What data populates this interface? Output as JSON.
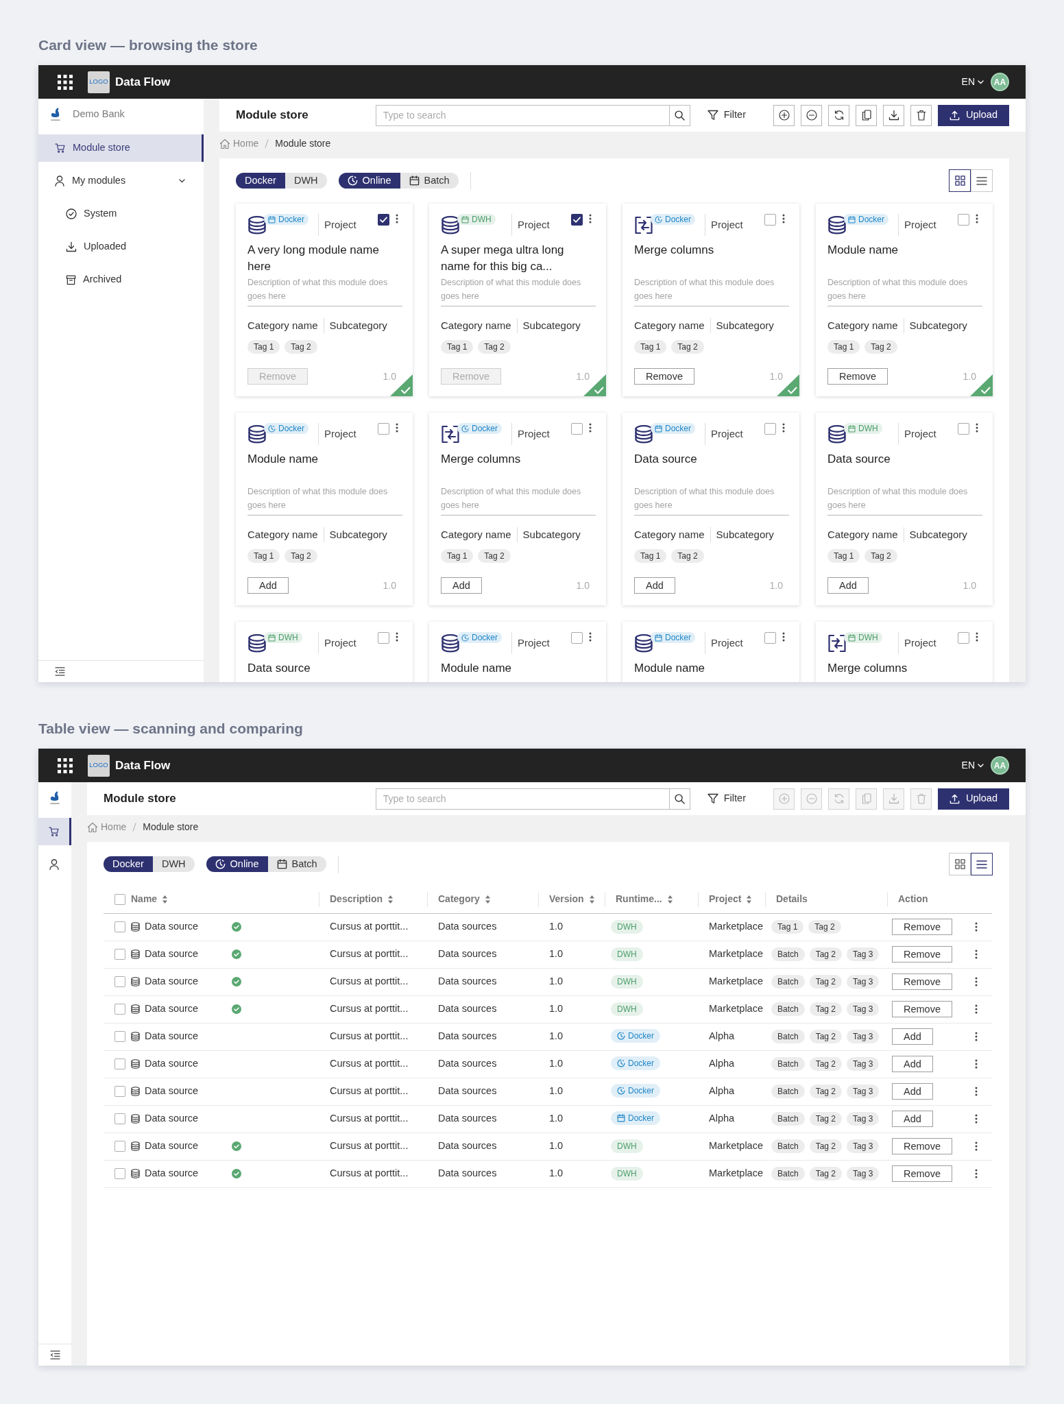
{
  "views": [
    {
      "kind": "cards",
      "caption": "Card view — browsing the store",
      "header": {
        "logo": "LOGO",
        "app_name": "Data Flow",
        "language": "EN",
        "avatar": "AA"
      },
      "sidebar": {
        "collapsed": false,
        "org": "Demo Bank",
        "items": [
          {
            "label": "Module store",
            "selected": true
          },
          {
            "label": "My modules",
            "selected": false,
            "expanded": true,
            "children": [
              {
                "label": "System",
                "selected": false
              },
              {
                "label": "Uploaded",
                "selected": false
              },
              {
                "label": "Archived",
                "selected": false
              }
            ]
          }
        ]
      },
      "toolbar": {
        "title": "Module store",
        "search": {
          "placeholder": "Type to search"
        },
        "filter": "Filter",
        "actions": [
          {
            "disabled": false
          },
          {
            "disabled": false
          },
          {
            "disabled": false
          },
          {
            "disabled": false
          },
          {
            "disabled": false
          },
          {
            "disabled": false
          }
        ],
        "upload": "Upload"
      },
      "breadcrumb": [
        "Home",
        "Module store"
      ],
      "filters": [
        [
          {
            "label": "Docker",
            "selected": true
          },
          {
            "label": "DWH",
            "selected": false
          }
        ],
        [
          {
            "label": "Online",
            "kind": "online",
            "selected": true
          },
          {
            "label": "Batch",
            "kind": "batch",
            "selected": false
          }
        ]
      ],
      "view_toggle": [
        {
          "selected": true
        },
        {
          "selected": false
        }
      ],
      "cards": [
        {
          "kind": "database",
          "runtime": {
            "label": "Docker",
            "kind": "batch",
            "color": "#1f86c8"
          },
          "project": "Project",
          "checked": true,
          "title": "A very long module name here",
          "description": "Description of what this module does goes here",
          "category": "Category name",
          "subcategory": "Subcategory",
          "tags": [
            "Tag 1",
            "Tag 2"
          ],
          "action": {
            "label": "Remove",
            "disabled": true
          },
          "version": "1.0",
          "installed": true
        },
        {
          "kind": "database",
          "runtime": {
            "label": "DWH",
            "kind": "batch",
            "color": "#4c9e6a"
          },
          "project": "Project",
          "checked": true,
          "title": "A super mega ultra long name for this big ca...",
          "description": "Description of what this module does goes here",
          "category": "Category name",
          "subcategory": "Subcategory",
          "tags": [
            "Tag 1",
            "Tag 2"
          ],
          "action": {
            "label": "Remove",
            "disabled": true
          },
          "version": "1.0",
          "installed": true
        },
        {
          "kind": "merge",
          "runtime": {
            "label": "Docker",
            "kind": "online",
            "color": "#1f86c8"
          },
          "project": "Project",
          "checked": false,
          "title": "Merge columns",
          "description": "Description of what this module does goes here",
          "category": "Category name",
          "subcategory": "Subcategory",
          "tags": [
            "Tag 1",
            "Tag 2"
          ],
          "action": {
            "label": "Remove",
            "disabled": false
          },
          "version": "1.0",
          "installed": true
        },
        {
          "kind": "database",
          "runtime": {
            "label": "Docker",
            "kind": "batch",
            "color": "#1f86c8"
          },
          "project": "Project",
          "checked": false,
          "title": "Module name",
          "description": "Description of what this module does goes here",
          "category": "Category name",
          "subcategory": "Subcategory",
          "tags": [
            "Tag 1",
            "Tag 2"
          ],
          "action": {
            "label": "Remove",
            "disabled": false
          },
          "version": "1.0",
          "installed": true
        },
        {
          "kind": "database",
          "runtime": {
            "label": "Docker",
            "kind": "online",
            "color": "#1f86c8"
          },
          "project": "Project",
          "checked": false,
          "title": "Module name",
          "description": "Description of what this module does goes here",
          "category": "Category name",
          "subcategory": "Subcategory",
          "tags": [
            "Tag 1",
            "Tag 2"
          ],
          "action": {
            "label": "Add",
            "disabled": false
          },
          "version": "1.0",
          "installed": false
        },
        {
          "kind": "merge",
          "runtime": {
            "label": "Docker",
            "kind": "online",
            "color": "#1f86c8"
          },
          "project": "Project",
          "checked": false,
          "title": "Merge columns",
          "description": "Description of what this module does goes here",
          "category": "Category name",
          "subcategory": "Subcategory",
          "tags": [
            "Tag 1",
            "Tag 2"
          ],
          "action": {
            "label": "Add",
            "disabled": false
          },
          "version": "1.0",
          "installed": false
        },
        {
          "kind": "database",
          "runtime": {
            "label": "Docker",
            "kind": "batch",
            "color": "#1f86c8"
          },
          "project": "Project",
          "checked": false,
          "title": "Data source",
          "description": "Description of what this module does goes here",
          "category": "Category name",
          "subcategory": "Subcategory",
          "tags": [
            "Tag 1",
            "Tag 2"
          ],
          "action": {
            "label": "Add",
            "disabled": false
          },
          "version": "1.0",
          "installed": false
        },
        {
          "kind": "database",
          "runtime": {
            "label": "DWH",
            "kind": "batch",
            "color": "#4c9e6a"
          },
          "project": "Project",
          "checked": false,
          "title": "Data source",
          "description": "Description of what this module does goes here",
          "category": "Category name",
          "subcategory": "Subcategory",
          "tags": [
            "Tag 1",
            "Tag 2"
          ],
          "action": {
            "label": "Add",
            "disabled": false
          },
          "version": "1.0",
          "installed": false
        },
        {
          "kind": "database",
          "runtime": {
            "label": "DWH",
            "kind": "batch",
            "color": "#4c9e6a"
          },
          "project": "Project",
          "checked": false,
          "title": "Data source"
        },
        {
          "kind": "database",
          "runtime": {
            "label": "Docker",
            "kind": "online",
            "color": "#1f86c8"
          },
          "project": "Project",
          "checked": false,
          "title": "Module name"
        },
        {
          "kind": "database",
          "runtime": {
            "label": "Docker",
            "kind": "batch",
            "color": "#1f86c8"
          },
          "project": "Project",
          "checked": false,
          "title": "Module name"
        },
        {
          "kind": "merge",
          "runtime": {
            "label": "DWH",
            "kind": "batch",
            "color": "#4c9e6a"
          },
          "project": "Project",
          "checked": false,
          "title": "Merge columns"
        }
      ]
    },
    {
      "kind": "table",
      "caption": "Table view — scanning and comparing",
      "header": {
        "logo": "LOGO",
        "app_name": "Data Flow",
        "language": "EN",
        "avatar": "AA"
      },
      "sidebar": {
        "collapsed": true,
        "items": [
          {
            "selected": true
          },
          {
            "selected": false
          }
        ]
      },
      "toolbar": {
        "title": "Module store",
        "search": {
          "placeholder": "Type to search"
        },
        "filter": "Filter",
        "actions": [
          {
            "disabled": true
          },
          {
            "disabled": true
          },
          {
            "disabled": true
          },
          {
            "disabled": true
          },
          {
            "disabled": true
          },
          {
            "disabled": true
          }
        ],
        "upload": "Upload"
      },
      "breadcrumb": [
        "Home",
        "Module store"
      ],
      "filters": [
        [
          {
            "label": "Docker",
            "selected": true
          },
          {
            "label": "DWH",
            "selected": false
          }
        ],
        [
          {
            "label": "Online",
            "kind": "online",
            "selected": true
          },
          {
            "label": "Batch",
            "kind": "batch",
            "selected": false
          }
        ]
      ],
      "view_toggle": [
        {
          "selected": false
        },
        {
          "selected": true
        }
      ],
      "table": {
        "all_checked": false,
        "columns": [
          {
            "label": "Name",
            "sortable": true
          },
          {
            "label": "Description",
            "sortable": true
          },
          {
            "label": "Category",
            "sortable": true
          },
          {
            "label": "Version",
            "sortable": true
          },
          {
            "label": "Runtime...",
            "sortable": true
          },
          {
            "label": "Project",
            "sortable": true
          },
          {
            "label": "Details",
            "sortable": false
          },
          {
            "label": "Action",
            "sortable": false
          }
        ],
        "rows": [
          {
            "checked": false,
            "name": "Data source",
            "installed": true,
            "description": "Cursus at porttit...",
            "category": "Data sources",
            "version": "1.0",
            "runtime": {
              "label": "DWH",
              "color": "#4c9e6a"
            },
            "project": "Marketplace",
            "tags": [
              "Tag 1",
              "Tag 2"
            ],
            "action": {
              "label": "Remove",
              "disabled": false
            }
          },
          {
            "checked": false,
            "name": "Data source",
            "installed": true,
            "description": "Cursus at porttit...",
            "category": "Data sources",
            "version": "1.0",
            "runtime": {
              "label": "DWH",
              "color": "#4c9e6a"
            },
            "project": "Marketplace",
            "tags": [
              "Batch",
              "Tag 2",
              "Tag 3"
            ],
            "action": {
              "label": "Remove",
              "disabled": false
            }
          },
          {
            "checked": false,
            "name": "Data source",
            "installed": true,
            "description": "Cursus at porttit...",
            "category": "Data sources",
            "version": "1.0",
            "runtime": {
              "label": "DWH",
              "color": "#4c9e6a"
            },
            "project": "Marketplace",
            "tags": [
              "Batch",
              "Tag 2",
              "Tag 3"
            ],
            "action": {
              "label": "Remove",
              "disabled": false
            }
          },
          {
            "checked": false,
            "name": "Data source",
            "installed": true,
            "description": "Cursus at porttit...",
            "category": "Data sources",
            "version": "1.0",
            "runtime": {
              "label": "DWH",
              "color": "#4c9e6a"
            },
            "project": "Marketplace",
            "tags": [
              "Batch",
              "Tag 2",
              "Tag 3"
            ],
            "action": {
              "label": "Remove",
              "disabled": false
            }
          },
          {
            "checked": false,
            "name": "Data source",
            "installed": false,
            "description": "Cursus at porttit...",
            "category": "Data sources",
            "version": "1.0",
            "runtime": {
              "label": "Docker",
              "kind": "online",
              "color": "#1f86c8"
            },
            "project": "Alpha",
            "tags": [
              "Batch",
              "Tag 2",
              "Tag 3"
            ],
            "action": {
              "label": "Add",
              "disabled": false
            }
          },
          {
            "checked": false,
            "name": "Data source",
            "installed": false,
            "description": "Cursus at porttit...",
            "category": "Data sources",
            "version": "1.0",
            "runtime": {
              "label": "Docker",
              "kind": "online",
              "color": "#1f86c8"
            },
            "project": "Alpha",
            "tags": [
              "Batch",
              "Tag 2",
              "Tag 3"
            ],
            "action": {
              "label": "Add",
              "disabled": false
            }
          },
          {
            "checked": false,
            "name": "Data source",
            "installed": false,
            "description": "Cursus at porttit...",
            "category": "Data sources",
            "version": "1.0",
            "runtime": {
              "label": "Docker",
              "kind": "online",
              "color": "#1f86c8"
            },
            "project": "Alpha",
            "tags": [
              "Batch",
              "Tag 2",
              "Tag 3"
            ],
            "action": {
              "label": "Add",
              "disabled": false
            }
          },
          {
            "checked": false,
            "name": "Data source",
            "installed": false,
            "description": "Cursus at porttit...",
            "category": "Data sources",
            "version": "1.0",
            "runtime": {
              "label": "Docker",
              "kind": "batch",
              "color": "#1f86c8"
            },
            "project": "Alpha",
            "tags": [
              "Batch",
              "Tag 2",
              "Tag 3"
            ],
            "action": {
              "label": "Add",
              "disabled": false
            }
          },
          {
            "checked": false,
            "name": "Data source",
            "installed": true,
            "description": "Cursus at porttit...",
            "category": "Data sources",
            "version": "1.0",
            "runtime": {
              "label": "DWH",
              "color": "#4c9e6a"
            },
            "project": "Marketplace",
            "tags": [
              "Batch",
              "Tag 2",
              "Tag 3"
            ],
            "action": {
              "label": "Remove",
              "disabled": false
            }
          },
          {
            "checked": false,
            "name": "Data source",
            "installed": true,
            "description": "Cursus at porttit...",
            "category": "Data sources",
            "version": "1.0",
            "runtime": {
              "label": "DWH",
              "color": "#4c9e6a"
            },
            "project": "Marketplace",
            "tags": [
              "Batch",
              "Tag 2",
              "Tag 3"
            ],
            "action": {
              "label": "Remove",
              "disabled": false
            }
          }
        ]
      }
    }
  ]
}
